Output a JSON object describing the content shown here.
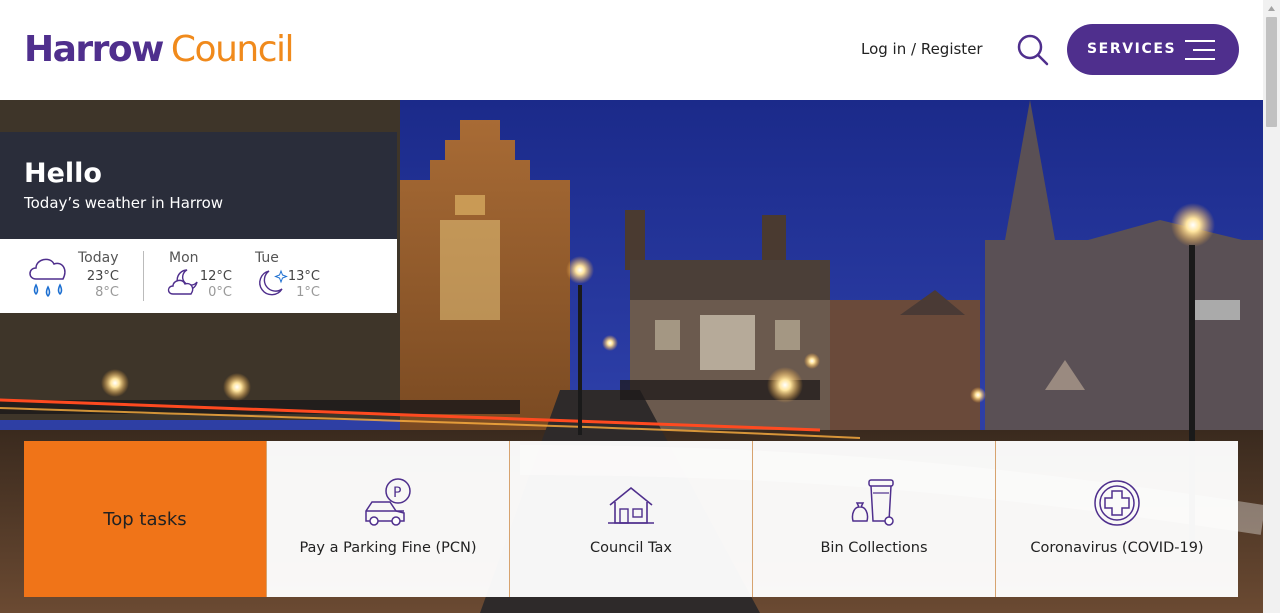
{
  "header": {
    "logo_part1": "Harrow",
    "logo_part2": "Council",
    "login_text": "Log in",
    "login_sep": " / ",
    "register_text": "Register",
    "services_label": "SERVICES"
  },
  "weather": {
    "greeting": "Hello",
    "subtitle": "Today’s weather in Harrow",
    "days": [
      {
        "name": "Today",
        "high": "23°C",
        "low": "8°C",
        "icon": "rain-cloud-icon"
      },
      {
        "name": "Mon",
        "high": "12°C",
        "low": "0°C",
        "icon": "cloudy-night-icon"
      },
      {
        "name": "Tue",
        "high": "13°C",
        "low": "1°C",
        "icon": "clear-night-icon"
      }
    ]
  },
  "tasks": {
    "title": "Top tasks",
    "items": [
      {
        "label": "Pay a Parking Fine (PCN)",
        "icon": "car-parking-icon"
      },
      {
        "label": "Council Tax",
        "icon": "house-icon"
      },
      {
        "label": "Bin Collections",
        "icon": "bin-icon"
      },
      {
        "label": "Coronavirus (COVID-19)",
        "icon": "medical-cross-icon"
      }
    ]
  },
  "colors": {
    "brand_purple": "#4f2f8d",
    "brand_orange": "#f08a1c",
    "tasks_orange": "#f07418"
  }
}
